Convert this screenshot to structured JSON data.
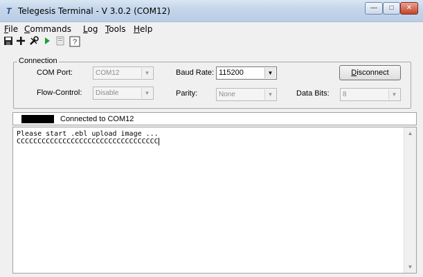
{
  "window": {
    "title": "Telegesis Terminal - V 3.0.2  (COM12)",
    "app_icon": "telegesis-logo-icon",
    "buttons": {
      "minimize": "—",
      "maximize": "□",
      "close": "✕"
    }
  },
  "menu": [
    {
      "mnemonic": "F",
      "rest": "ile"
    },
    {
      "mnemonic": "C",
      "rest": "ommands"
    },
    {
      "mnemonic": "L",
      "rest": "og"
    },
    {
      "mnemonic": "T",
      "rest": "ools"
    },
    {
      "mnemonic": "H",
      "rest": "elp"
    }
  ],
  "toolbar": {
    "icons": [
      "save-icon",
      "add-icon",
      "tools-icon",
      "run-icon",
      "document-icon",
      "help-icon"
    ]
  },
  "connection": {
    "legend": "Connection",
    "com_port_label": "COM Port:",
    "com_port_value": "COM12",
    "baud_rate_label": "Baud Rate:",
    "baud_rate_value": "115200",
    "flow_control_label": "Flow-Control:",
    "flow_control_value": "Disable",
    "parity_label": "Parity:",
    "parity_value": "None",
    "data_bits_label": "Data Bits:",
    "data_bits_value": "8",
    "disconnect_mnemonic": "D",
    "disconnect_rest": "isconnect"
  },
  "status": {
    "text": "Connected to COM12",
    "indicator_color": "#000000"
  },
  "terminal": {
    "lines": [
      "Please start .ebl upload image ...",
      "CCCCCCCCCCCCCCCCCCCCCCCCCCCCCCCCCC"
    ]
  },
  "colors": {
    "title_bar": "#c5d6ea",
    "close_button": "#c4442a",
    "run_icon": "#1e9e2e"
  }
}
